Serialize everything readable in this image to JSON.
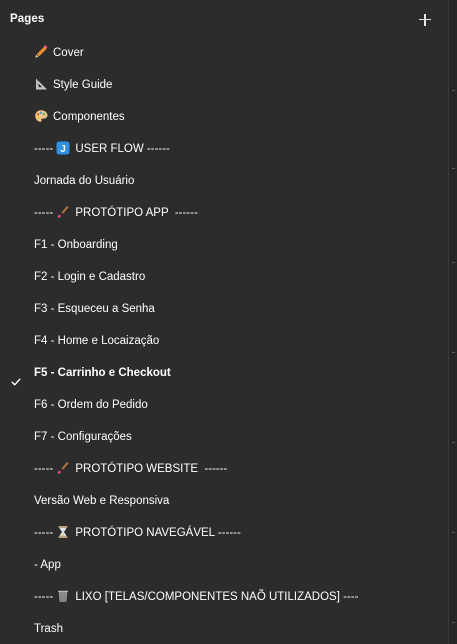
{
  "header": {
    "title": "Pages"
  },
  "pages": [
    {
      "label": "Cover",
      "icon": "pencil-icon",
      "selected": false
    },
    {
      "label": "Style Guide",
      "icon": "triangular-ruler-icon",
      "selected": false
    },
    {
      "label": "Componentes",
      "icon": "palette-icon",
      "selected": false
    },
    {
      "prefix": "----- ",
      "label": "USER FLOW ------",
      "icon": "j-badge-icon",
      "selected": false
    },
    {
      "label": "Jornada do Usuário",
      "selected": false
    },
    {
      "prefix": "----- ",
      "label": "PROTÓTIPO APP  ------",
      "icon": "paintbrush-icon",
      "selected": false
    },
    {
      "label": "F1 - Onboarding",
      "selected": false
    },
    {
      "label": "F2 - Login e Cadastro",
      "selected": false
    },
    {
      "label": "F3 - Esqueceu a Senha",
      "selected": false
    },
    {
      "label": "F4 - Home e Locaização",
      "selected": false
    },
    {
      "label": "F5 - Carrinho e Checkout",
      "selected": true
    },
    {
      "label": "F6 - Ordem do Pedido",
      "selected": false
    },
    {
      "label": "F7 - Configurações",
      "selected": false
    },
    {
      "prefix": "----- ",
      "label": "PROTÓTIPO WEBSITE  ------",
      "icon": "paintbrush-icon",
      "selected": false
    },
    {
      "label": "Versão Web e Responsiva",
      "selected": false
    },
    {
      "prefix": "----- ",
      "label": "PROTÓTIPO NAVEGÁVEL ------",
      "icon": "hourglass-icon",
      "selected": false
    },
    {
      "label": "- App",
      "selected": false
    },
    {
      "prefix": "----- ",
      "label": "LIXO [TELAS/COMPONENTES NAÕ UTILIZADOS] ----",
      "icon": "wastebasket-icon",
      "selected": false
    },
    {
      "label": "Trash",
      "selected": false
    }
  ],
  "colors": {
    "background": "#2c2c2c",
    "text": "#ffffff"
  }
}
